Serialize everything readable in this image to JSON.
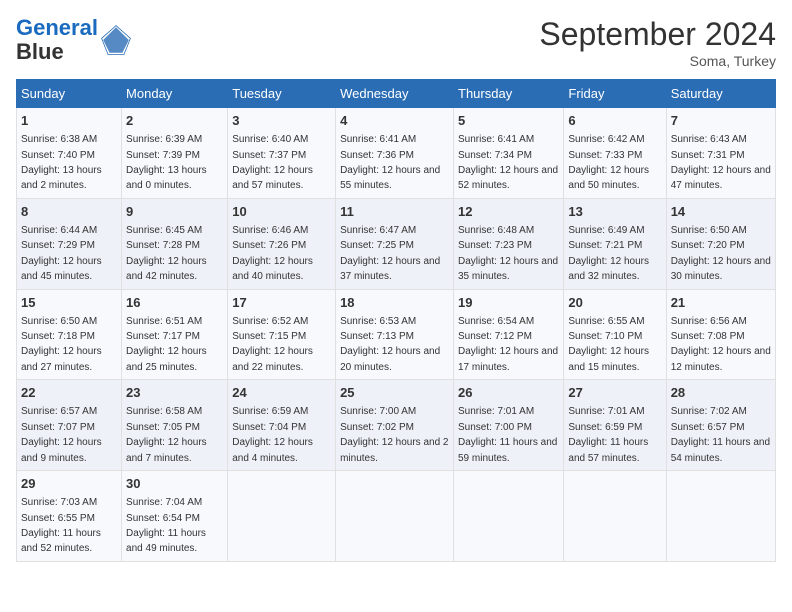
{
  "header": {
    "logo_line1": "General",
    "logo_line2": "Blue",
    "month_year": "September 2024",
    "location": "Soma, Turkey"
  },
  "days_of_week": [
    "Sunday",
    "Monday",
    "Tuesday",
    "Wednesday",
    "Thursday",
    "Friday",
    "Saturday"
  ],
  "weeks": [
    [
      {
        "day": "1",
        "sunrise": "6:38 AM",
        "sunset": "7:40 PM",
        "daylight": "13 hours and 2 minutes."
      },
      {
        "day": "2",
        "sunrise": "6:39 AM",
        "sunset": "7:39 PM",
        "daylight": "13 hours and 0 minutes."
      },
      {
        "day": "3",
        "sunrise": "6:40 AM",
        "sunset": "7:37 PM",
        "daylight": "12 hours and 57 minutes."
      },
      {
        "day": "4",
        "sunrise": "6:41 AM",
        "sunset": "7:36 PM",
        "daylight": "12 hours and 55 minutes."
      },
      {
        "day": "5",
        "sunrise": "6:41 AM",
        "sunset": "7:34 PM",
        "daylight": "12 hours and 52 minutes."
      },
      {
        "day": "6",
        "sunrise": "6:42 AM",
        "sunset": "7:33 PM",
        "daylight": "12 hours and 50 minutes."
      },
      {
        "day": "7",
        "sunrise": "6:43 AM",
        "sunset": "7:31 PM",
        "daylight": "12 hours and 47 minutes."
      }
    ],
    [
      {
        "day": "8",
        "sunrise": "6:44 AM",
        "sunset": "7:29 PM",
        "daylight": "12 hours and 45 minutes."
      },
      {
        "day": "9",
        "sunrise": "6:45 AM",
        "sunset": "7:28 PM",
        "daylight": "12 hours and 42 minutes."
      },
      {
        "day": "10",
        "sunrise": "6:46 AM",
        "sunset": "7:26 PM",
        "daylight": "12 hours and 40 minutes."
      },
      {
        "day": "11",
        "sunrise": "6:47 AM",
        "sunset": "7:25 PM",
        "daylight": "12 hours and 37 minutes."
      },
      {
        "day": "12",
        "sunrise": "6:48 AM",
        "sunset": "7:23 PM",
        "daylight": "12 hours and 35 minutes."
      },
      {
        "day": "13",
        "sunrise": "6:49 AM",
        "sunset": "7:21 PM",
        "daylight": "12 hours and 32 minutes."
      },
      {
        "day": "14",
        "sunrise": "6:50 AM",
        "sunset": "7:20 PM",
        "daylight": "12 hours and 30 minutes."
      }
    ],
    [
      {
        "day": "15",
        "sunrise": "6:50 AM",
        "sunset": "7:18 PM",
        "daylight": "12 hours and 27 minutes."
      },
      {
        "day": "16",
        "sunrise": "6:51 AM",
        "sunset": "7:17 PM",
        "daylight": "12 hours and 25 minutes."
      },
      {
        "day": "17",
        "sunrise": "6:52 AM",
        "sunset": "7:15 PM",
        "daylight": "12 hours and 22 minutes."
      },
      {
        "day": "18",
        "sunrise": "6:53 AM",
        "sunset": "7:13 PM",
        "daylight": "12 hours and 20 minutes."
      },
      {
        "day": "19",
        "sunrise": "6:54 AM",
        "sunset": "7:12 PM",
        "daylight": "12 hours and 17 minutes."
      },
      {
        "day": "20",
        "sunrise": "6:55 AM",
        "sunset": "7:10 PM",
        "daylight": "12 hours and 15 minutes."
      },
      {
        "day": "21",
        "sunrise": "6:56 AM",
        "sunset": "7:08 PM",
        "daylight": "12 hours and 12 minutes."
      }
    ],
    [
      {
        "day": "22",
        "sunrise": "6:57 AM",
        "sunset": "7:07 PM",
        "daylight": "12 hours and 9 minutes."
      },
      {
        "day": "23",
        "sunrise": "6:58 AM",
        "sunset": "7:05 PM",
        "daylight": "12 hours and 7 minutes."
      },
      {
        "day": "24",
        "sunrise": "6:59 AM",
        "sunset": "7:04 PM",
        "daylight": "12 hours and 4 minutes."
      },
      {
        "day": "25",
        "sunrise": "7:00 AM",
        "sunset": "7:02 PM",
        "daylight": "12 hours and 2 minutes."
      },
      {
        "day": "26",
        "sunrise": "7:01 AM",
        "sunset": "7:00 PM",
        "daylight": "11 hours and 59 minutes."
      },
      {
        "day": "27",
        "sunrise": "7:01 AM",
        "sunset": "6:59 PM",
        "daylight": "11 hours and 57 minutes."
      },
      {
        "day": "28",
        "sunrise": "7:02 AM",
        "sunset": "6:57 PM",
        "daylight": "11 hours and 54 minutes."
      }
    ],
    [
      {
        "day": "29",
        "sunrise": "7:03 AM",
        "sunset": "6:55 PM",
        "daylight": "11 hours and 52 minutes."
      },
      {
        "day": "30",
        "sunrise": "7:04 AM",
        "sunset": "6:54 PM",
        "daylight": "11 hours and 49 minutes."
      },
      {
        "day": "",
        "sunrise": "",
        "sunset": "",
        "daylight": ""
      },
      {
        "day": "",
        "sunrise": "",
        "sunset": "",
        "daylight": ""
      },
      {
        "day": "",
        "sunrise": "",
        "sunset": "",
        "daylight": ""
      },
      {
        "day": "",
        "sunrise": "",
        "sunset": "",
        "daylight": ""
      },
      {
        "day": "",
        "sunrise": "",
        "sunset": "",
        "daylight": ""
      }
    ]
  ]
}
